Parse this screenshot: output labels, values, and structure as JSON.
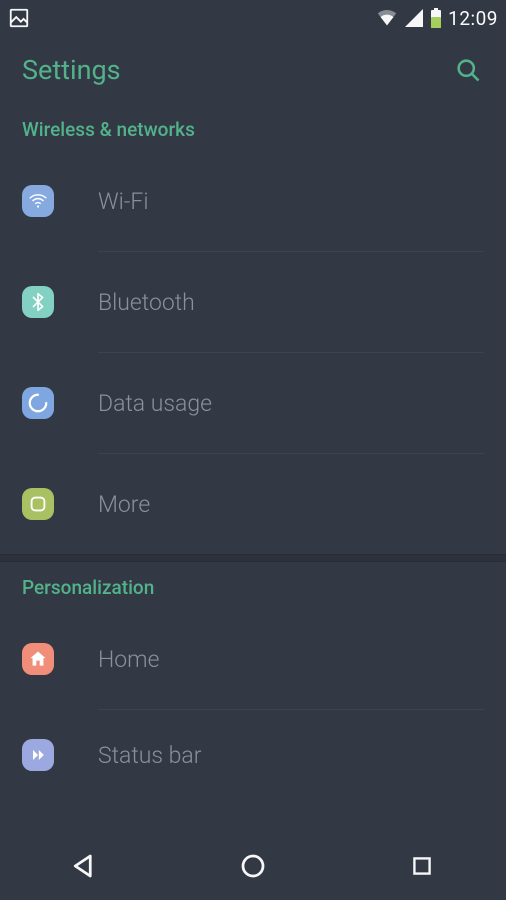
{
  "status": {
    "time": "12:09"
  },
  "appbar": {
    "title": "Settings"
  },
  "sections": {
    "wireless": {
      "title": "Wireless & networks",
      "items": {
        "wifi": {
          "label": "Wi-Fi"
        },
        "bluetooth": {
          "label": "Bluetooth"
        },
        "data": {
          "label": "Data usage"
        },
        "more": {
          "label": "More"
        }
      }
    },
    "personalization": {
      "title": "Personalization",
      "items": {
        "home": {
          "label": "Home"
        },
        "statusbar": {
          "label": "Status bar"
        }
      }
    }
  }
}
